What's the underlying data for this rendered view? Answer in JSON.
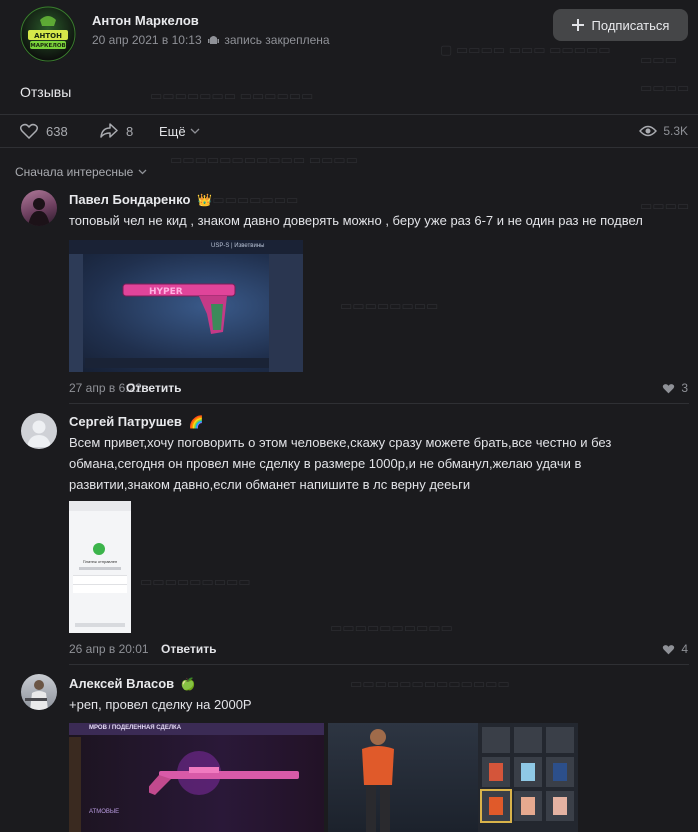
{
  "post": {
    "author": "Антон Маркелов",
    "date": "20 апр 2021 в 10:13",
    "pinned": "запись закреплена",
    "subscribe_label": "Подписаться",
    "text": "Отзывы",
    "likes": "638",
    "shares": "8",
    "more_label": "Ещё",
    "views": "5.3K",
    "logo_text": "АНТОН МАРКЕЛОВ"
  },
  "comments_sort": "Сначала интересные",
  "comments": [
    {
      "name": "Павел Бондаренко",
      "emoji": "👑",
      "text": "топовый чел не кид , знаком давно доверять можно , беру уже раз 6-7 и не один раз не подвел",
      "date": "27 апр в 6:22",
      "reply": "Ответить",
      "likes": "3",
      "image": {
        "header": "USP-S | Изветвины",
        "stickers": "HYPER"
      }
    },
    {
      "name": "Сергей Патрушев",
      "emoji": "🌈",
      "text": "Всем привет,хочу поговорить о этом человеке,скажу сразу можете брать,все честно и без обмана,сегодня он провел мне сделку в размере 1000р,и не обманул,желаю удачи в развитии,знаком давно,если обманет напишите в лс верну дееьги",
      "date": "26 апр в 20:01",
      "reply": "Ответить",
      "likes": "4",
      "image": {
        "title": "Платеж отправлен"
      }
    },
    {
      "name": "Алексей Власов",
      "emoji": "🍏",
      "text": "+реп, провел сделку на 2000Р",
      "image": {
        "header": "МРОВ / ПОДЕЛЕННАЯ СДЕЛКА",
        "side": "АТМОВЫЕ"
      }
    }
  ],
  "colors": {
    "bg": "#1b1b1e",
    "button": "#454648",
    "accent": "#c0307a"
  },
  "icons": [
    "heart-icon",
    "share-icon",
    "chevron-down-icon",
    "eye-icon",
    "plus-icon",
    "android-icon"
  ]
}
